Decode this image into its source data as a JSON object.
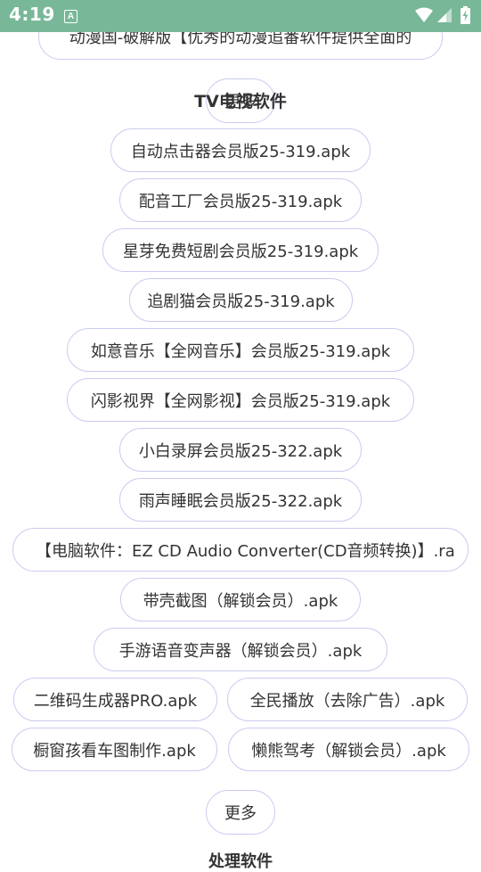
{
  "status_bar": {
    "time": "4:19",
    "notification_icon": "a-letter-icon",
    "wifi_icon": "wifi-icon",
    "signal_icon": "cell-signal-icon",
    "battery_icon": "battery-charging-icon"
  },
  "previous_section": {
    "last_item": "动漫国-破解版【优秀的动漫追番软件提供全面的",
    "more_label": "更多"
  },
  "tv_section": {
    "title": "TV电视软件",
    "items": [
      "自动点击器会员版25-319.apk",
      "配音工厂会员版25-319.apk",
      "星芽免费短剧会员版25-319.apk",
      "追剧猫会员版25-319.apk",
      "如意音乐【全网音乐】会员版25-319.apk",
      "闪影视界【全网影视】会员版25-319.apk",
      "小白录屏会员版25-322.apk",
      "雨声睡眠会员版25-322.apk",
      "【电脑软件：EZ CD Audio Converter(CD音频转换)】.ra",
      "带壳截图（解锁会员）.apk",
      "手游语音变声器（解锁会员）.apk",
      "二维码生成器PRO.apk",
      "全民播放（去除广告）.apk",
      "橱窗孩看车图制作.apk",
      "懒熊驾考（解锁会员）.apk"
    ],
    "more_label": "更多"
  },
  "next_section": {
    "title": "处理软件"
  },
  "colors": {
    "status_bar": "#78b899",
    "pill_border": "#c9cbf0",
    "text": "#333333"
  }
}
